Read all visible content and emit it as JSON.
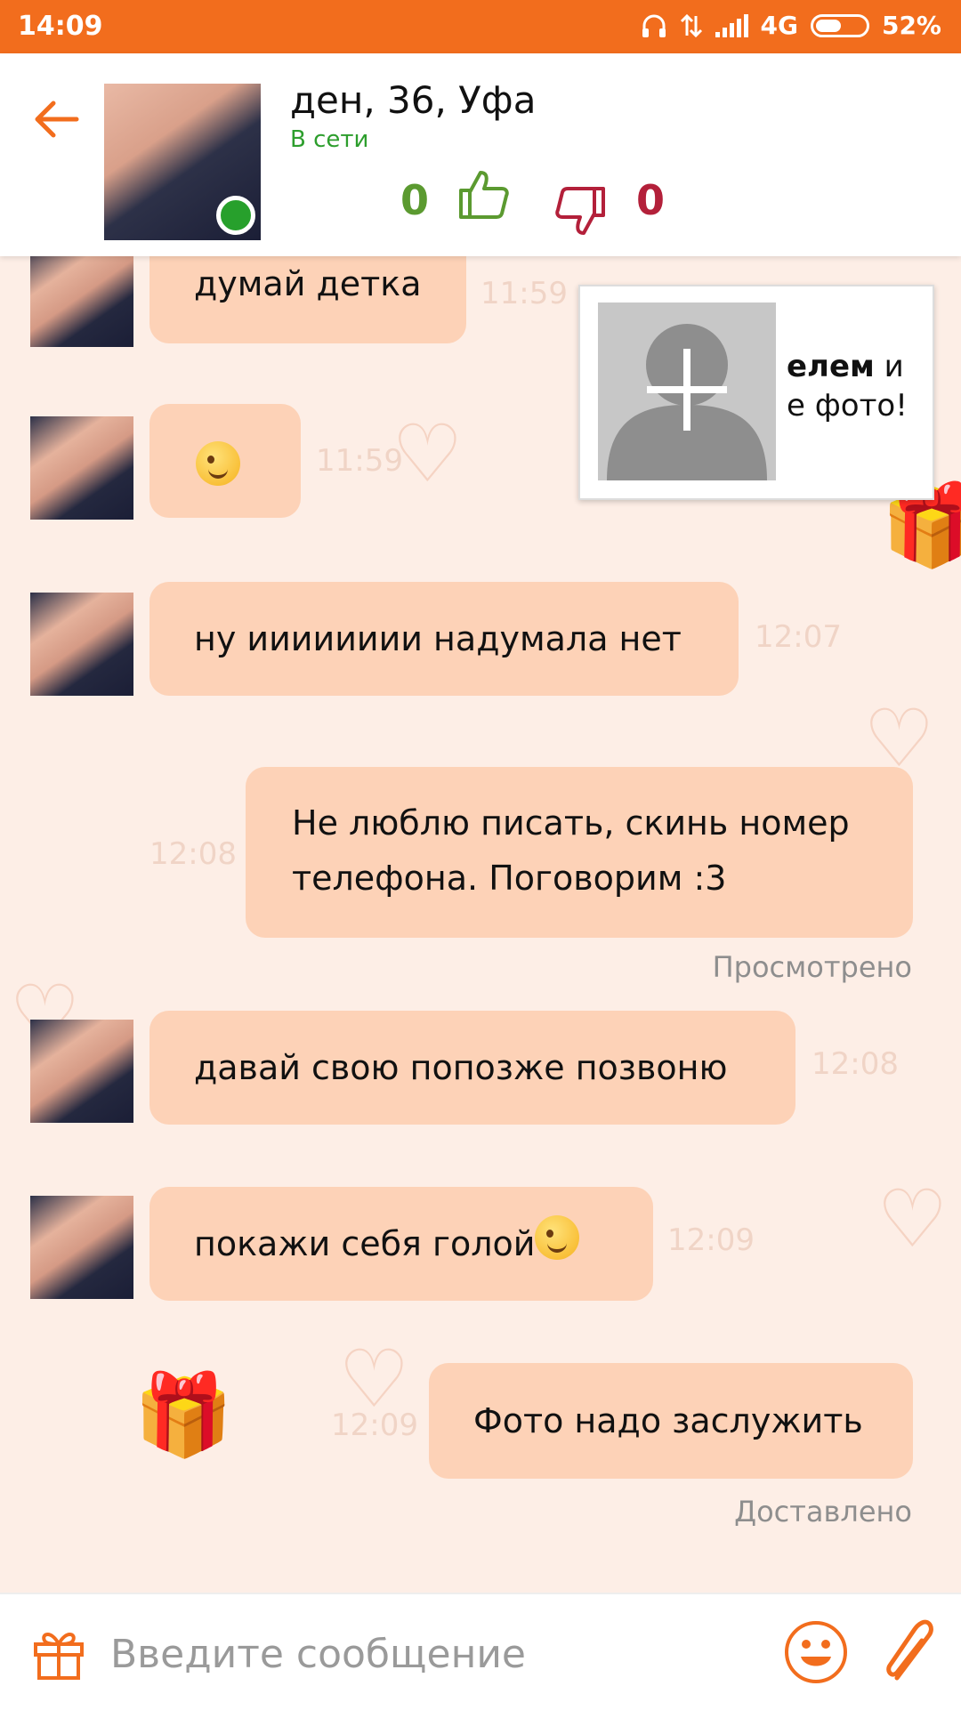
{
  "status_bar": {
    "time": "14:09",
    "network": "4G",
    "battery": "52%",
    "battery_level": 0.52
  },
  "header": {
    "back_icon": "arrow-left-icon",
    "contact_name": "ден, 36, Уфа",
    "status": "В сети",
    "likes": "0",
    "dislikes": "0",
    "accent": "#f26d1d"
  },
  "popup": {
    "line1_bold": "елем",
    "line1_rest": " и",
    "line2": "е фото!"
  },
  "messages": [
    {
      "dir": "in",
      "text": "думай детка",
      "time": "11:59"
    },
    {
      "dir": "in",
      "text": "",
      "emoji": "wink-emoji",
      "time": "11:59"
    },
    {
      "dir": "in",
      "text": "ну ииииииии надумала нет",
      "time": "12:07"
    },
    {
      "dir": "out",
      "text": "Не люблю писать, скинь номер телефона. Поговорим :3",
      "time": "12:08",
      "receipt": "Просмотрено"
    },
    {
      "dir": "in",
      "text": "давай свою попозже позвоню",
      "time": "12:08"
    },
    {
      "dir": "in",
      "text": "покажи себя голой",
      "emoji": "wink-emoji",
      "time": "12:09"
    },
    {
      "dir": "out",
      "text": "Фото надо заслужить",
      "time": "12:09",
      "receipt": "Доставлено"
    }
  ],
  "input": {
    "placeholder": "Введите сообщение"
  }
}
